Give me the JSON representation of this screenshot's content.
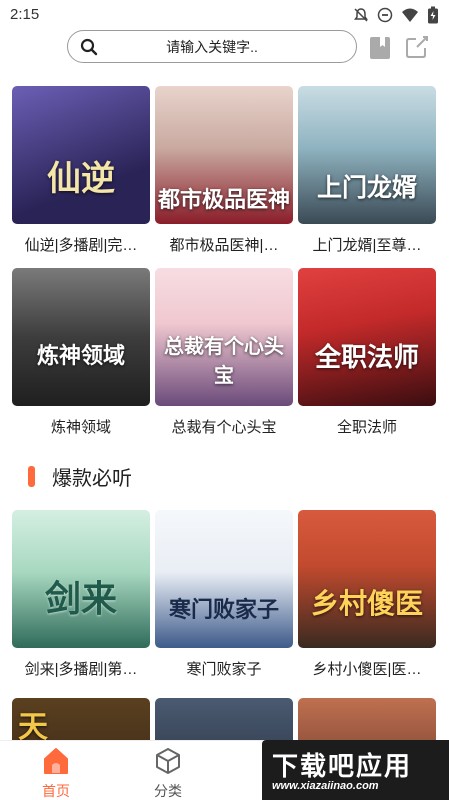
{
  "status_bar": {
    "time": "2:15"
  },
  "search": {
    "placeholder": "请输入关键字.."
  },
  "rows": [
    {
      "books": [
        {
          "title": "仙逆|多播剧|完…",
          "cover_text": "仙逆",
          "colors": [
            "#2a2356",
            "#6b5fb5"
          ]
        },
        {
          "title": "都市极品医神|…",
          "cover_text": "都市极品医神",
          "colors": [
            "#c9a9a0",
            "#8a1d2a"
          ]
        },
        {
          "title": "上门龙婿|至尊…",
          "cover_text": "上门龙婿",
          "colors": [
            "#8fb3c0",
            "#3a4a55"
          ]
        }
      ]
    },
    {
      "books": [
        {
          "title": "炼神领域",
          "cover_text": "炼神领域",
          "colors": [
            "#5a5a5a",
            "#1f1f1f"
          ]
        },
        {
          "title": "总裁有个心头宝",
          "cover_text": "总裁有个心头宝",
          "colors": [
            "#f0c8d0",
            "#6a4a7a"
          ]
        },
        {
          "title": "全职法师",
          "cover_text": "全职法师",
          "colors": [
            "#c42a2a",
            "#3a0d10"
          ]
        }
      ]
    }
  ],
  "section": {
    "title": "爆款必听",
    "books": [
      {
        "title": "剑来|多播剧|第…",
        "cover_text": "剑来",
        "colors": [
          "#a8d8c0",
          "#2f6b5a"
        ]
      },
      {
        "title": "寒门败家子",
        "cover_text": "寒门败家子",
        "colors": [
          "#e9eef5",
          "#3d5a8a"
        ]
      },
      {
        "title": "乡村小傻医|医…",
        "cover_text": "乡村傻医",
        "colors": [
          "#c24a2e",
          "#3a2a20"
        ]
      }
    ],
    "partial_covers": [
      {
        "cover_text": "天",
        "colors": [
          "#5a4020",
          "#2a1a10"
        ]
      },
      {
        "colors": [
          "#4a5a70",
          "#1a2030"
        ]
      },
      {
        "colors": [
          "#c07050",
          "#40201a"
        ]
      }
    ]
  },
  "bottom_nav": {
    "items": [
      {
        "label": "首页",
        "icon": "home-icon",
        "active": true
      },
      {
        "label": "分类",
        "icon": "cube-icon",
        "active": false
      }
    ],
    "active_color": "#ff6a3c",
    "inactive_color": "#555555"
  },
  "watermark": {
    "main": "下载吧应用",
    "url": "www.xiazaiinao.com"
  }
}
